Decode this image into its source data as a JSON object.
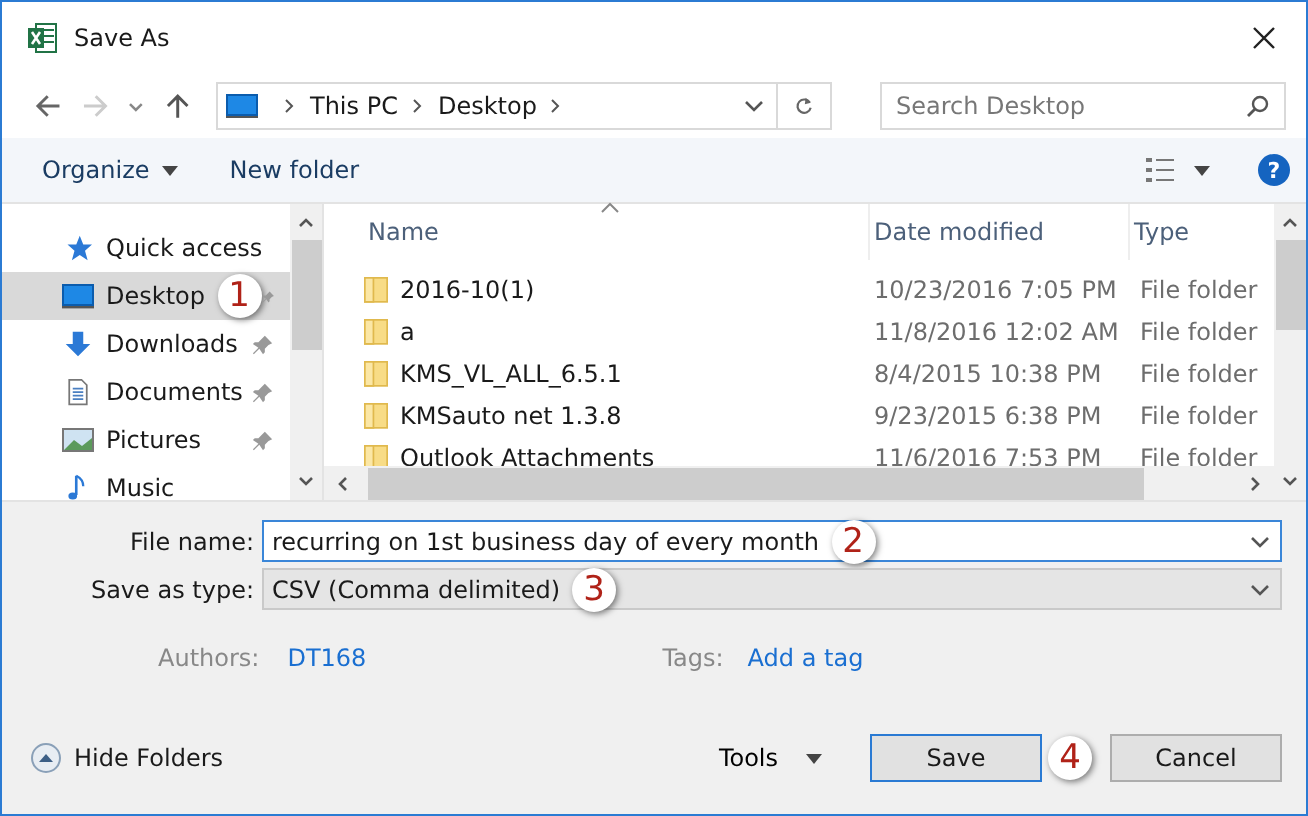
{
  "window": {
    "title": "Save As"
  },
  "address": {
    "path": [
      "This PC",
      "Desktop"
    ]
  },
  "search": {
    "placeholder": "Search Desktop"
  },
  "toolbar": {
    "organize": "Organize",
    "new_folder": "New folder",
    "help": "?"
  },
  "sidebar": {
    "items": [
      {
        "label": "Quick access",
        "kind": "header",
        "selected": false,
        "pinned": false
      },
      {
        "label": "Desktop",
        "kind": "desktop",
        "selected": true,
        "pinned": true,
        "callout": "1"
      },
      {
        "label": "Downloads",
        "kind": "downloads",
        "selected": false,
        "pinned": true
      },
      {
        "label": "Documents",
        "kind": "documents",
        "selected": false,
        "pinned": true
      },
      {
        "label": "Pictures",
        "kind": "pictures",
        "selected": false,
        "pinned": true
      },
      {
        "label": "Music",
        "kind": "music",
        "selected": false,
        "pinned": false
      }
    ]
  },
  "table": {
    "columns": [
      "Name",
      "Date modified",
      "Type"
    ],
    "rows": [
      {
        "name": "2016-10(1)",
        "date": "10/23/2016 7:05 PM",
        "type": "File folder"
      },
      {
        "name": "a",
        "date": "11/8/2016 12:02 AM",
        "type": "File folder"
      },
      {
        "name": "KMS_VL_ALL_6.5.1",
        "date": "8/4/2015 10:38 PM",
        "type": "File folder"
      },
      {
        "name": "KMSauto net 1.3.8",
        "date": "9/23/2015 6:38 PM",
        "type": "File folder"
      },
      {
        "name": "Outlook Attachments",
        "date": "11/6/2016 7:53 PM",
        "type": "File folder"
      }
    ]
  },
  "form": {
    "file_name": {
      "label": "File name:",
      "value": "recurring on 1st business day of every month",
      "callout": "2"
    },
    "save_as_type": {
      "label": "Save as type:",
      "value": "CSV (Comma delimited)",
      "callout": "3"
    },
    "authors": {
      "label": "Authors:",
      "value": "DT168"
    },
    "tags": {
      "label": "Tags:",
      "value": "Add a tag"
    }
  },
  "footer": {
    "hide_folders": "Hide Folders",
    "tools": "Tools",
    "save": {
      "label": "Save",
      "callout": "4"
    },
    "cancel": "Cancel"
  }
}
